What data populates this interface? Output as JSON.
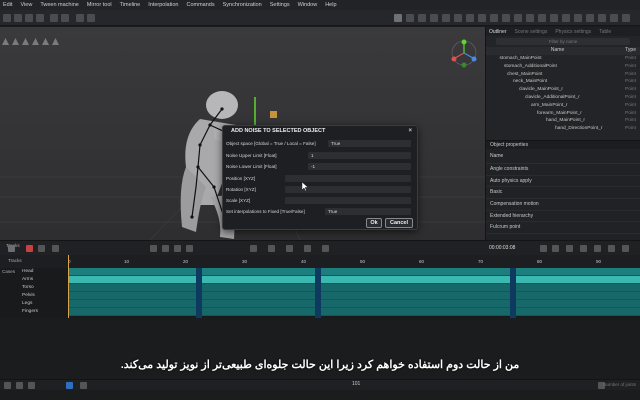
{
  "menu": [
    "Edit",
    "View",
    "Tween machine",
    "Mirror tool",
    "Timeline",
    "Interpolation",
    "Commands",
    "Synchronization",
    "Settings",
    "Window",
    "Help"
  ],
  "outliner": {
    "tabs": [
      "Outliner",
      "Scene settings",
      "Physics settings",
      "Table"
    ],
    "search_placeholder": "Filter by name",
    "col_name": "Name",
    "col_type": "Type",
    "rows": [
      {
        "name": "stomach_MainPoint",
        "type": "Point",
        "indent": 9
      },
      {
        "name": "stomach_AdditionalPoint",
        "type": "Point",
        "indent": 12
      },
      {
        "name": "chest_MainPoint",
        "type": "Point",
        "indent": 14
      },
      {
        "name": "neck_MainPoint",
        "type": "Point",
        "indent": 18
      },
      {
        "name": "clavicle_MainPoint_r",
        "type": "Point",
        "indent": 22
      },
      {
        "name": "clavicle_AdditionalPoint_r",
        "type": "Point",
        "indent": 26
      },
      {
        "name": "arm_MainPoint_r",
        "type": "Point",
        "indent": 30
      },
      {
        "name": "forearm_MainPoint_r",
        "type": "Point",
        "indent": 34
      },
      {
        "name": "hand_MainPoint_r",
        "type": "Point",
        "indent": 40
      },
      {
        "name": "hand_DirectionPoint_r",
        "type": "Point",
        "indent": 46
      }
    ]
  },
  "properties": {
    "title": "Object properties",
    "name_label": "Name",
    "items": [
      "Angle constraints",
      "Auto physics apply",
      "Basic",
      "Compensation motion",
      "Extended hierarchy",
      "Fulcrum point"
    ]
  },
  "dialog": {
    "title": "ADD NOISE TO SELECTED OBJECT",
    "close": "×",
    "rows": {
      "object_space": {
        "label": "Object space [Global = True / Local = False]",
        "value": "True"
      },
      "noise_upper": {
        "label": "Noise Upper Limit [Float]",
        "value": "1"
      },
      "noise_lower": {
        "label": "Noise Lower Limit [Float]",
        "value": "-1"
      },
      "position": {
        "label": "Position [XYZ]",
        "value": ""
      },
      "rotation": {
        "label": "Rotation [XYZ]",
        "value": ""
      },
      "scale": {
        "label": "Scale [XYZ]",
        "value": ""
      },
      "interp": {
        "label": "Set interpolations to Fixed [True/False]",
        "value": "True"
      }
    },
    "ok": "Ok",
    "cancel": "Cancel"
  },
  "timeline": {
    "tracks_label": "Tracks",
    "layer_label": "Cases",
    "time": "00:00:03:08",
    "ruler": [
      "0",
      "10",
      "20",
      "30",
      "40",
      "50",
      "60",
      "70",
      "80",
      "90"
    ],
    "tracks": [
      "Head",
      "Arms",
      "Torso",
      "Pelvis",
      "Legs",
      "Fingers"
    ],
    "frame": "101"
  },
  "subtitle": "من از حالت دوم استفاده خواهم کرد زیرا این حالت جلوه‌ای طبیعی‌تر از نویز تولید می‌کند.",
  "version": "Number of joints"
}
